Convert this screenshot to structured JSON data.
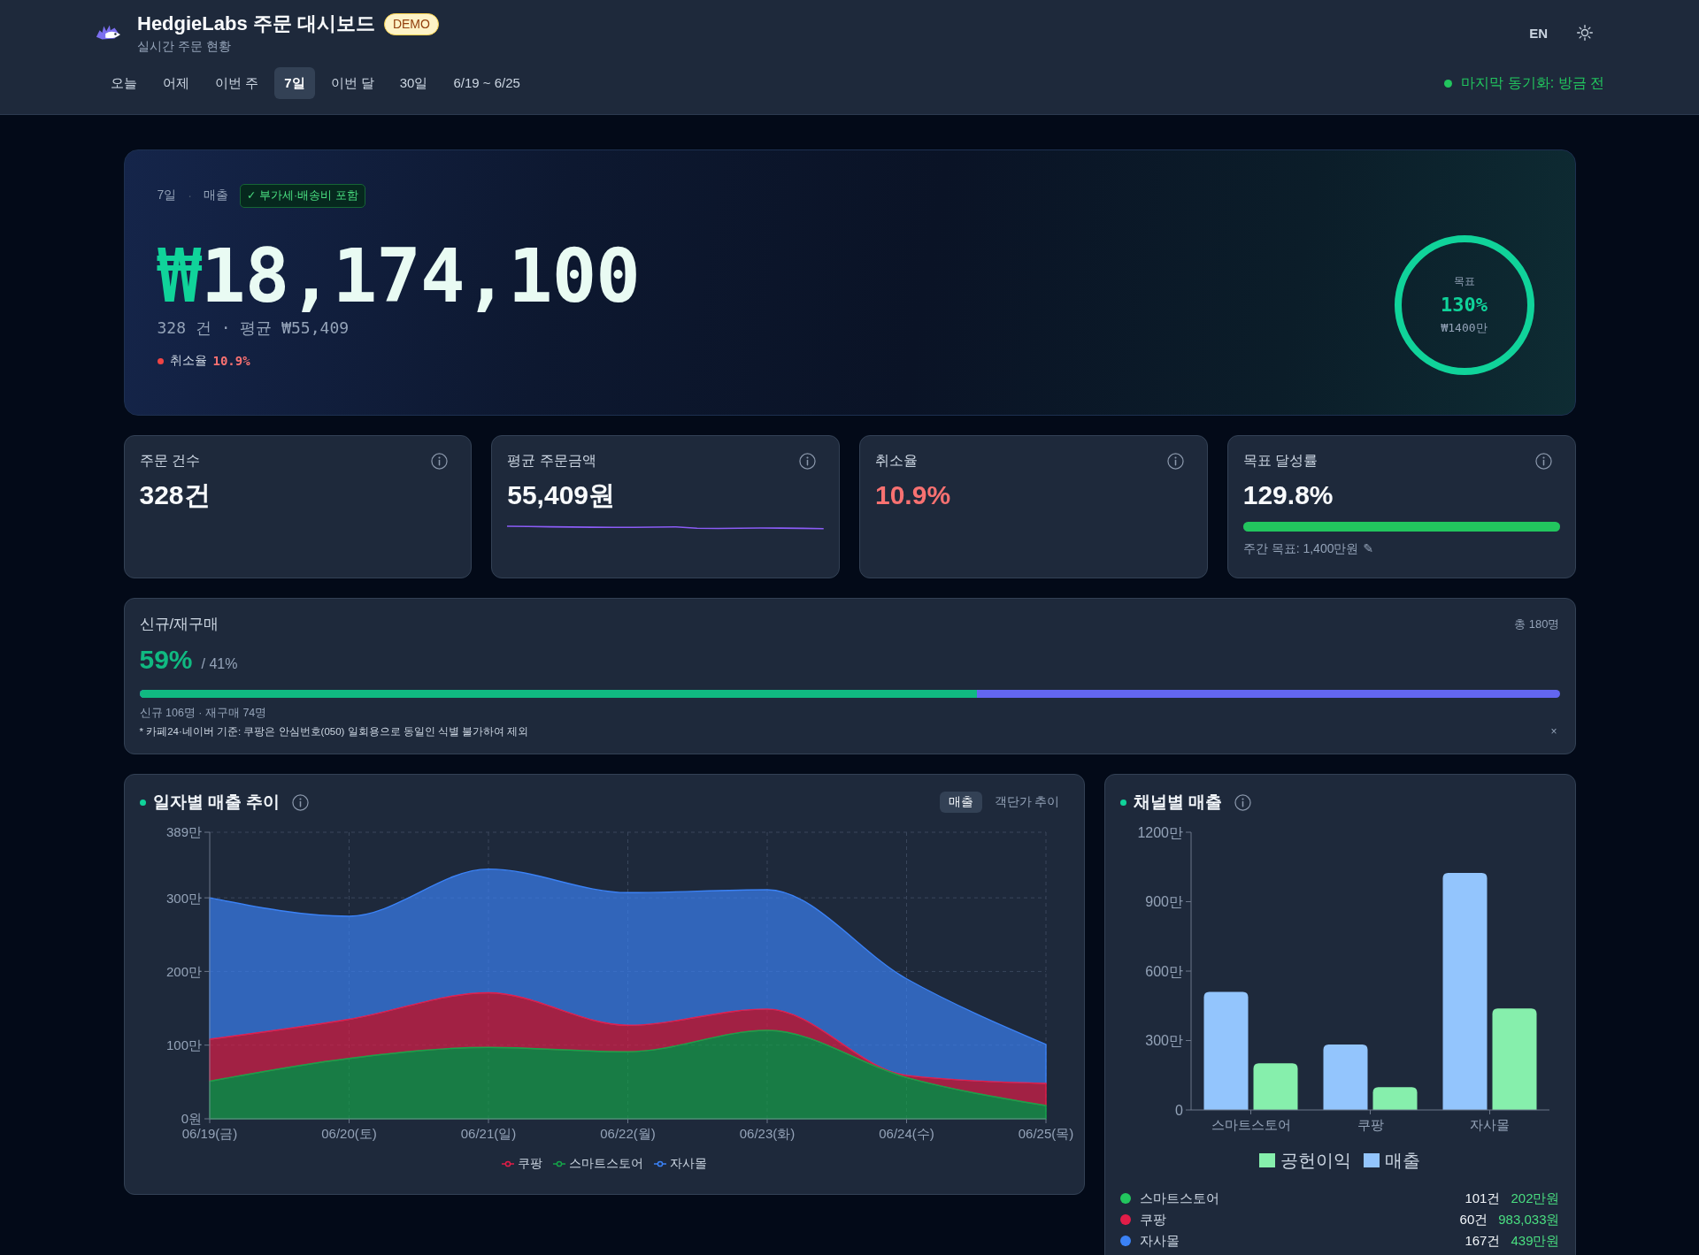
{
  "header": {
    "title": "HedgieLabs 주문 대시보드",
    "badge": "DEMO",
    "subtitle": "실시간 주문 현황",
    "language": "EN",
    "date_tabs": [
      {
        "label": "오늘",
        "selected": false
      },
      {
        "label": "어제",
        "selected": false
      },
      {
        "label": "이번 주",
        "selected": false
      },
      {
        "label": "7일",
        "selected": true
      },
      {
        "label": "이번 달",
        "selected": false
      },
      {
        "label": "30일",
        "selected": false
      },
      {
        "label": "6/19 ~ 6/25",
        "selected": false
      }
    ],
    "sync_status": "마지막 동기화: 방금 전"
  },
  "hero": {
    "period": "7일",
    "separator": "·",
    "metric": "매출",
    "tax_badge": "✓ 부가세·배송비 포함",
    "currency": "₩",
    "amount": "18,174,100",
    "summary": "328 건 · 평균 ₩55,409",
    "cancel_label": "취소율",
    "cancel_rate": "10.9%",
    "goal": {
      "label": "목표",
      "percent": "130%",
      "target": "₩1400만",
      "level": 1
    }
  },
  "kpis": [
    {
      "kind": "plain",
      "label": "주문 건수",
      "value": "328건"
    },
    {
      "kind": "sparkline",
      "label": "평균 주문금액",
      "value": "55,409원"
    },
    {
      "kind": "alert",
      "label": "취소율",
      "value": "10.9%"
    },
    {
      "kind": "progress",
      "label": "목표 달성률",
      "value": "129.8%",
      "level": 1,
      "note": "주간 목표: 1,400만원",
      "edit_glyph": "✎"
    }
  ],
  "customers": {
    "title": "신규/재구매",
    "total": "총 180명",
    "new_share": "59%",
    "repeat_share": "/ 41%",
    "level": 0.59,
    "breakdown": "신규 106명 · 재구매 74명",
    "note": "* 카페24·네이버 기준: 쿠팡은 안심번호(050) 일회용으로 동일인 식별 불가하여 제외",
    "close_glyph": "×"
  },
  "daily_chart": {
    "title": "일자별 매출 추이",
    "toggle": [
      {
        "label": "매출",
        "selected": true
      },
      {
        "label": "객단가 추이",
        "selected": false
      }
    ],
    "chart_data": {
      "type": "area",
      "stacked": true,
      "grid": true,
      "categories": [
        "06/19(금)",
        "06/20(토)",
        "06/21(일)",
        "06/22(월)",
        "06/23(화)",
        "06/24(수)",
        "06/25(목)"
      ],
      "series": [
        {
          "name": "쿠팡",
          "color": "#e11d48",
          "values": [
            57,
            53,
            74,
            36,
            29,
            3,
            30
          ]
        },
        {
          "name": "스마트스토어",
          "color": "#16a34a",
          "values": [
            51,
            82,
            97,
            91,
            120,
            56,
            18
          ]
        },
        {
          "name": "자사몰",
          "color": "#3b82f6",
          "values": [
            192,
            140,
            168,
            180,
            162,
            131,
            53
          ]
        }
      ],
      "ylim": [
        0,
        389
      ],
      "yticks": [
        {
          "value": 0,
          "label": "0원"
        },
        {
          "value": 100,
          "label": "100만"
        },
        {
          "value": 200,
          "label": "200만"
        },
        {
          "value": 300,
          "label": "300만"
        },
        {
          "value": 389,
          "label": "389만"
        }
      ]
    }
  },
  "channel_chart": {
    "title": "채널별 매출",
    "chart_data": {
      "type": "bar",
      "categories": [
        "스마트스토어",
        "쿠팡",
        "자사몰"
      ],
      "series": [
        {
          "name": "매출",
          "color": "#93c5fd",
          "values": [
            510,
            283,
            1024
          ]
        },
        {
          "name": "공헌이익",
          "color": "#86efac",
          "values": [
            202,
            98,
            439
          ]
        }
      ],
      "ylim": [
        0,
        1200
      ],
      "yticks": [
        {
          "value": 0,
          "label": "0"
        },
        {
          "value": 300,
          "label": "300만"
        },
        {
          "value": 600,
          "label": "600만"
        },
        {
          "value": 900,
          "label": "900만"
        },
        {
          "value": 1200,
          "label": "1200만"
        }
      ]
    },
    "channels": [
      {
        "name": "스마트스토어",
        "color": "#22c55e",
        "orders": "101건",
        "amount": "202만원"
      },
      {
        "name": "쿠팡",
        "color": "#e11d48",
        "orders": "60건",
        "amount": "983,033원"
      },
      {
        "name": "자사몰",
        "color": "#3b82f6",
        "orders": "167건",
        "amount": "439만원"
      }
    ]
  }
}
